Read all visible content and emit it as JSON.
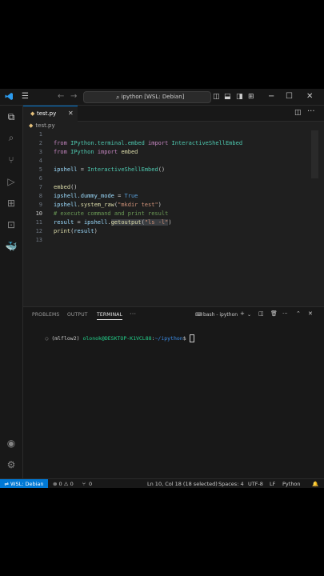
{
  "titlebar": {
    "command_center": "ipython [WSL: Debian]",
    "nav_back": "←",
    "nav_forward": "→"
  },
  "tab": {
    "filename": "test.py",
    "lang_glyph": "◆"
  },
  "breadcrumb": {
    "file": "test.py"
  },
  "editor": {
    "lines": [
      {
        "n": "1"
      },
      {
        "n": "2"
      },
      {
        "n": "3"
      },
      {
        "n": "4"
      },
      {
        "n": "5"
      },
      {
        "n": "6"
      },
      {
        "n": "7"
      },
      {
        "n": "8"
      },
      {
        "n": "9"
      },
      {
        "n": "10"
      },
      {
        "n": "11"
      },
      {
        "n": "12"
      },
      {
        "n": "13"
      }
    ],
    "tokens": {
      "l1": [
        "from",
        "IPython.terminal.embed",
        "import",
        "InteractiveShellEmbed"
      ],
      "l2": [
        "from",
        "IPython",
        "import",
        "embed"
      ],
      "l4": [
        "ipshell",
        " = ",
        "InteractiveShellEmbed",
        "()"
      ],
      "l6": [
        "embed",
        "()"
      ],
      "l7": [
        "ipshell",
        ".dummy_mode",
        " = ",
        "True"
      ],
      "l8": [
        "ipshell",
        ".system_raw",
        "(",
        "\"mkdir test\"",
        ")"
      ],
      "l9": "# execute command and print result",
      "l10": [
        "result",
        " = ",
        "ipshell",
        ".",
        "getoutput",
        "(",
        "\"ls -l\"",
        ")"
      ],
      "l11": [
        "print",
        "(",
        "result",
        ")"
      ]
    }
  },
  "panel": {
    "tabs": [
      "PROBLEMS",
      "OUTPUT",
      "TERMINAL"
    ],
    "more": "···",
    "terminal_name": "bash - ipython",
    "terminal": {
      "env": "(mlflow2) ",
      "user": "olonok@DESKTOP-K1VCL88",
      "sep": ":",
      "path": "~/ipython",
      "prompt": "$ "
    }
  },
  "status": {
    "remote": "WSL: Debian",
    "errors": "⊗ 0 ⚠ 0",
    "ports": "0",
    "position": "Ln 10, Col 18 (18 selected)",
    "spaces": "Spaces: 4",
    "encoding": "UTF-8",
    "eol": "LF",
    "language": "Python"
  },
  "colors": {
    "accent": "#0078d4",
    "background": "#1f1f1f"
  }
}
